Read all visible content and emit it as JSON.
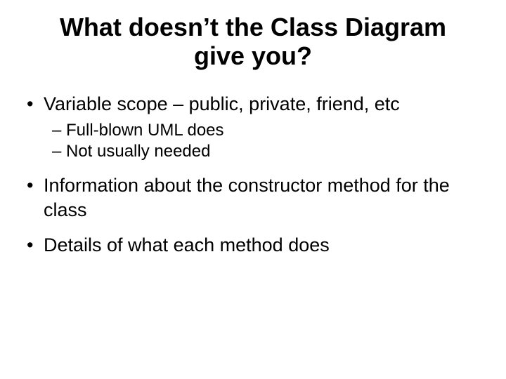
{
  "title": "What doesn’t the Class Diagram give you?",
  "bullets": {
    "b0": "Variable scope – public, private, friend, etc",
    "b0_sub0": "Full-blown UML does",
    "b0_sub1": "Not usually needed",
    "b1": "Information about the constructor method for the class",
    "b2": "Details of what each method does"
  }
}
